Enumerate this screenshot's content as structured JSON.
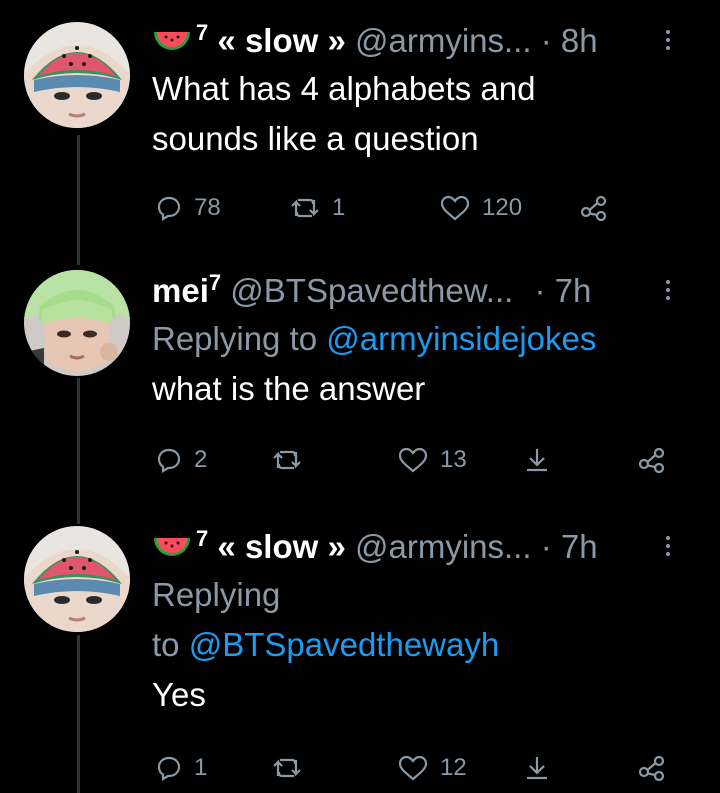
{
  "tweets": [
    {
      "name_suffix": "7",
      "name": "« slow »",
      "handle": "@armyins...",
      "dot": "·",
      "time": "8h",
      "text_lines": [
        "What has 4 alphabets and",
        "sounds like a question"
      ],
      "actions": {
        "replies": "78",
        "retweets": "1",
        "likes": "120"
      }
    },
    {
      "name": "mei",
      "name_suffix": "7",
      "handle": "@BTSpavedthew...",
      "dot": "·",
      "time": "7h",
      "reply_prefix": "Replying to",
      "reply_mention": "@armyinsidejokes",
      "text_lines": [
        "what is the answer"
      ],
      "actions": {
        "replies": "2",
        "retweets": "",
        "likes": "13"
      }
    },
    {
      "name_suffix": "7",
      "name": "« slow »",
      "handle": "@armyins...",
      "dot": "·",
      "time": "7h",
      "reply_prefix": "Replying",
      "reply_prefix_2": "to",
      "reply_mention": "@BTSpavedthewayh",
      "text_lines": [
        "Yes"
      ],
      "actions": {
        "replies": "1",
        "retweets": "",
        "likes": "12"
      }
    }
  ],
  "colors": {
    "background": "#000000",
    "text": "#ffffff",
    "secondary": "#8b98a5",
    "link": "#1d9bf0",
    "thread_line": "#2f3336"
  },
  "icons": [
    "watermelon-icon",
    "reply-icon",
    "retweet-icon",
    "like-icon",
    "share-icon",
    "more-icon"
  ]
}
